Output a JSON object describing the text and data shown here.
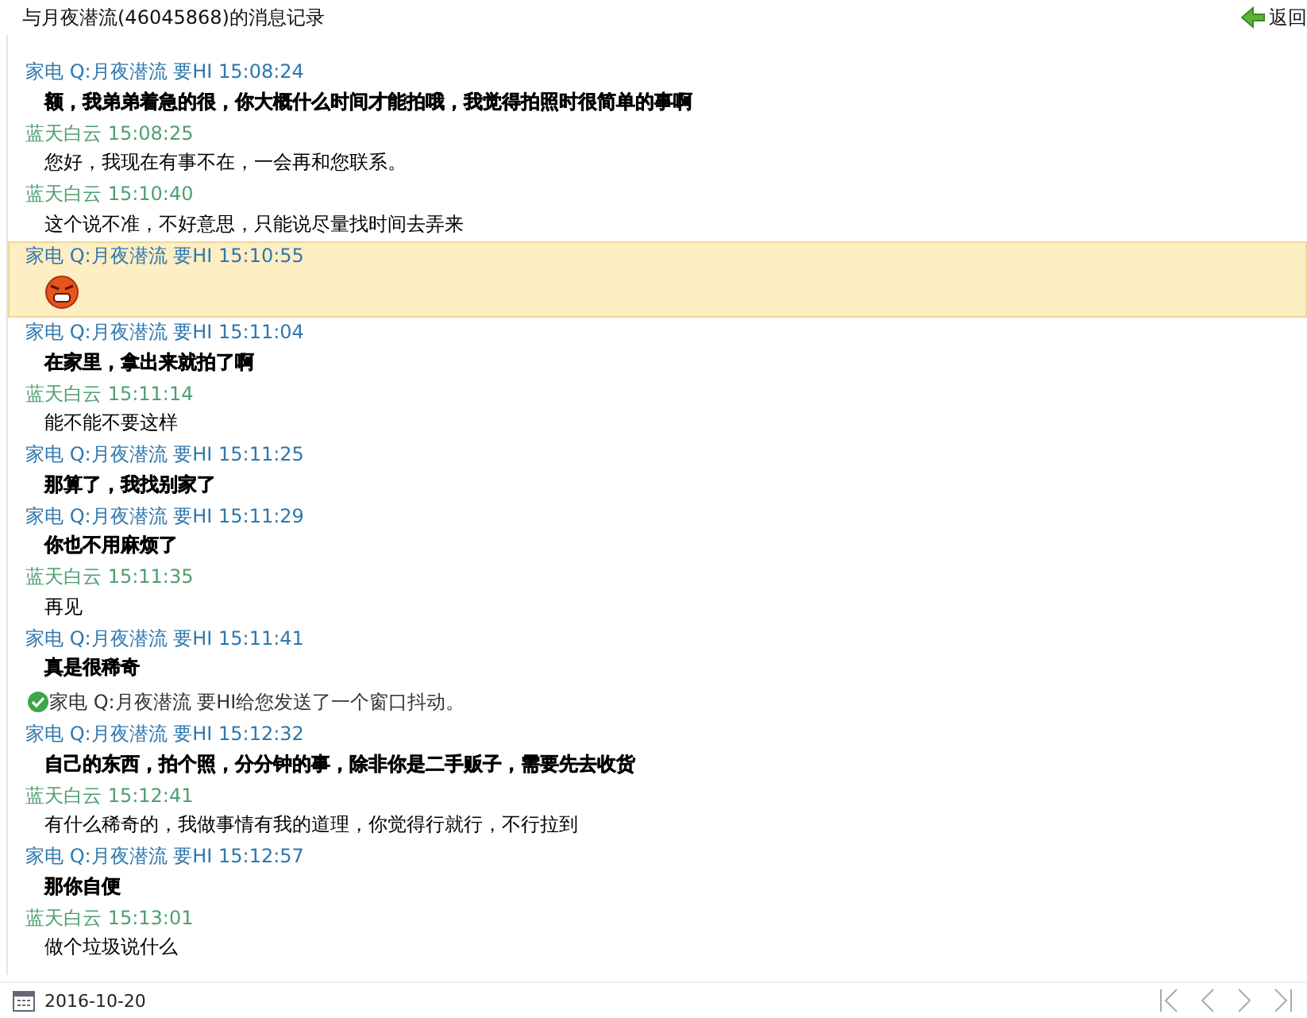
{
  "window": {
    "title": "与月夜潜流(46045868)的消息记录",
    "back_label": "返回"
  },
  "messages": [
    {
      "kind": "text",
      "sender": "家电 Q:月夜潜流 要HI",
      "time": "15:08:24",
      "color": "#2f77ad",
      "bold": true,
      "highlighted": false,
      "text": "额，我弟弟着急的很，你大概什么时间才能拍哦，我觉得拍照时很简单的事啊"
    },
    {
      "kind": "text",
      "sender": "蓝天白云",
      "time": "15:08:25",
      "color": "#4e9e72",
      "bold": false,
      "highlighted": false,
      "text": "您好，我现在有事不在，一会再和您联系。"
    },
    {
      "kind": "text",
      "sender": "蓝天白云",
      "time": "15:10:40",
      "color": "#4e9e72",
      "bold": false,
      "highlighted": false,
      "text": "这个说不准，不好意思，只能说尽量找时间去弄来"
    },
    {
      "kind": "emoji",
      "sender": "家电 Q:月夜潜流 要HI",
      "time": "15:10:55",
      "color": "#2f77ad",
      "highlighted": true
    },
    {
      "kind": "text",
      "sender": "家电 Q:月夜潜流 要HI",
      "time": "15:11:04",
      "color": "#2f77ad",
      "bold": true,
      "highlighted": false,
      "text": "在家里，拿出来就拍了啊"
    },
    {
      "kind": "text",
      "sender": "蓝天白云",
      "time": "15:11:14",
      "color": "#4e9e72",
      "bold": false,
      "highlighted": false,
      "text": "能不能不要这样"
    },
    {
      "kind": "text",
      "sender": "家电 Q:月夜潜流 要HI",
      "time": "15:11:25",
      "color": "#2f77ad",
      "bold": true,
      "highlighted": false,
      "text": "那算了，我找别家了"
    },
    {
      "kind": "text",
      "sender": "家电 Q:月夜潜流 要HI",
      "time": "15:11:29",
      "color": "#2f77ad",
      "bold": true,
      "highlighted": false,
      "text": "你也不用麻烦了"
    },
    {
      "kind": "text",
      "sender": "蓝天白云",
      "time": "15:11:35",
      "color": "#4e9e72",
      "bold": false,
      "highlighted": false,
      "text": "再见"
    },
    {
      "kind": "text",
      "sender": "家电 Q:月夜潜流 要HI",
      "time": "15:11:41",
      "color": "#2f77ad",
      "bold": true,
      "highlighted": false,
      "text": "真是很稀奇"
    },
    {
      "kind": "notice",
      "text": "家电 Q:月夜潜流 要HI给您发送了一个窗口抖动。"
    },
    {
      "kind": "text",
      "sender": "家电 Q:月夜潜流 要HI",
      "time": "15:12:32",
      "color": "#2f77ad",
      "bold": true,
      "highlighted": false,
      "text": "自己的东西，拍个照，分分钟的事，除非你是二手贩子，需要先去收货"
    },
    {
      "kind": "text",
      "sender": "蓝天白云",
      "time": "15:12:41",
      "color": "#4e9e72",
      "bold": false,
      "highlighted": false,
      "text": "有什么稀奇的，我做事情有我的道理，你觉得行就行，不行拉到"
    },
    {
      "kind": "text",
      "sender": "家电 Q:月夜潜流 要HI",
      "time": "15:12:57",
      "color": "#2f77ad",
      "bold": true,
      "highlighted": false,
      "text": "那你自便"
    },
    {
      "kind": "text",
      "sender": "蓝天白云",
      "time": "15:13:01",
      "color": "#4e9e72",
      "bold": false,
      "highlighted": false,
      "text": "做个垃圾说什么"
    }
  ],
  "footer": {
    "date": "2016-10-20"
  }
}
